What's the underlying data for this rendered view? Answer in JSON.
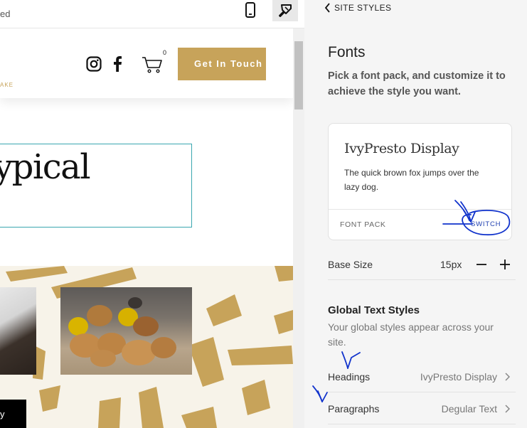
{
  "topbar": {
    "status_fragment": "ed",
    "mobile_icon": "mobile-phone-icon",
    "style_icon": "paintbrush-icon"
  },
  "site": {
    "logo_fragment": "AKE",
    "cart_count": "0",
    "cta_label": "Get In Touch",
    "hero_text": "ypical",
    "button_fragment": "y",
    "colors": {
      "accent": "#c7a35a",
      "cream": "#f7f3e9",
      "outline": "#3aa6b0"
    }
  },
  "panel": {
    "back_label": "SITE STYLES",
    "title": "Fonts",
    "description": "Pick a font pack, and customize it to achieve the style you want.",
    "font_card": {
      "font_name": "IvyPresto Display",
      "sample": "The quick brown fox jumps over the lazy dog.",
      "pack_label": "FONT PACK",
      "switch_label": "SWITCH"
    },
    "base_size": {
      "label": "Base Size",
      "value": "15px"
    },
    "global_styles": {
      "title": "Global Text Styles",
      "description": "Your global styles appear across your site.",
      "rows": [
        {
          "label": "Headings",
          "value": "IvyPresto Display"
        },
        {
          "label": "Paragraphs",
          "value": "Degular Text"
        }
      ]
    },
    "annotation_color": "#1133cc"
  }
}
